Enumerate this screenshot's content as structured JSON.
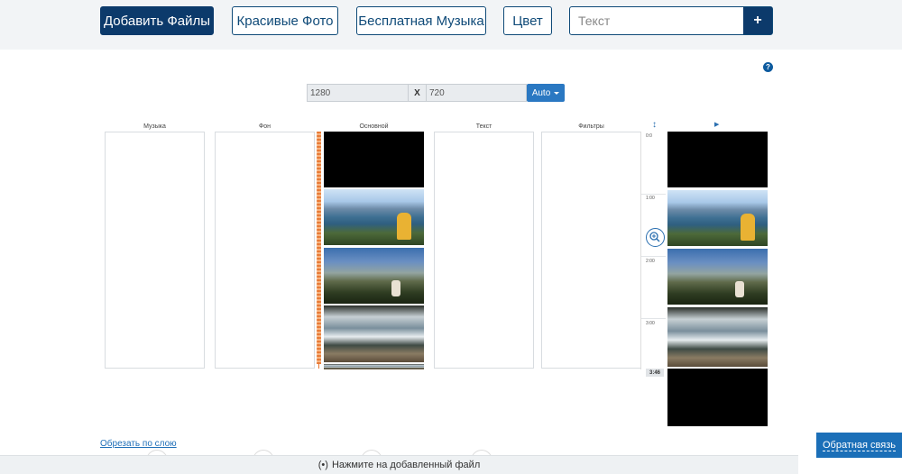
{
  "header": {
    "add_files_label": "Добавить Файлы",
    "beautiful_photos_label": "Красивые Фото",
    "free_music_label": "Бесплатная Музыка",
    "color_label": "Цвет",
    "search_placeholder": "Текст",
    "add_text_label": "+"
  },
  "help_label": "?",
  "resolution": {
    "width": "1280",
    "separator": "X",
    "height": "720",
    "preset": "Auto"
  },
  "columns": {
    "music": "Музыка",
    "background": "Фон",
    "main": "Основной",
    "text": "Текст",
    "filters": "Фильтры"
  },
  "timeline": {
    "ticks": [
      "0:0",
      "1:00",
      "2:00",
      "3:00"
    ],
    "end_time": "3:46"
  },
  "main_track_clips": [
    "black",
    "lake",
    "grass",
    "creek"
  ],
  "preview_clips": [
    "black",
    "lake",
    "grass",
    "creek",
    "black"
  ],
  "footer": {
    "cut_by_layer": "Обрезать по слою",
    "hint_icon": "(•)",
    "hint": "Нажмите на добавленный файл",
    "feedback": "Обратная связь"
  },
  "colors": {
    "primary": "#0c3a6b",
    "accent": "#2a78c2",
    "waveform": "#e8742c"
  }
}
